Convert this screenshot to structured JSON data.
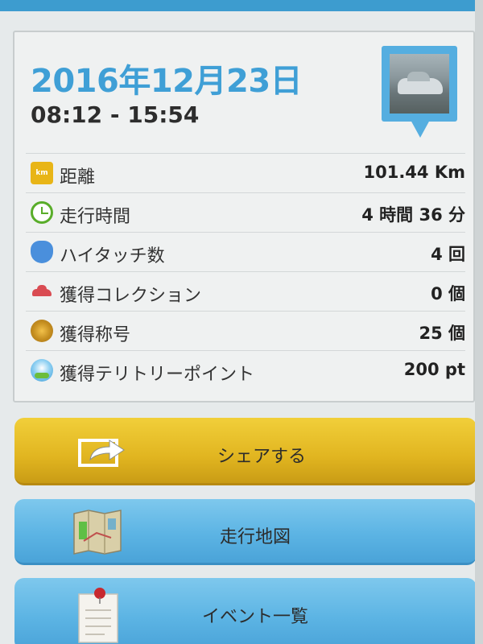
{
  "summary": {
    "date": "2016年12月23日",
    "time_range": "08:12 - 15:54",
    "stats": [
      {
        "icon": "km-badge-icon",
        "label": "距離",
        "value": "101.44 Km"
      },
      {
        "icon": "clock-icon",
        "label": "走行時間",
        "value": "4 時間 36 分"
      },
      {
        "icon": "high-five-hand-icon",
        "label": "ハイタッチ数",
        "value": "4 回"
      },
      {
        "icon": "car-icon",
        "label": "獲得コレクション",
        "value": "0 個"
      },
      {
        "icon": "medal-icon",
        "label": "獲得称号",
        "value": "25 個"
      },
      {
        "icon": "territory-globe-icon",
        "label": "獲得テリトリーポイント",
        "value": "200 pt"
      }
    ],
    "km_icon_text": "km"
  },
  "actions": {
    "share_label": "シェアする",
    "map_label": "走行地図",
    "events_label": "イベント一覧"
  },
  "colors": {
    "date_blue": "#3f9fd6",
    "share_yellow": "#e1b520",
    "button_blue": "#5cb4e4",
    "top_bar": "#3d9ccf"
  }
}
